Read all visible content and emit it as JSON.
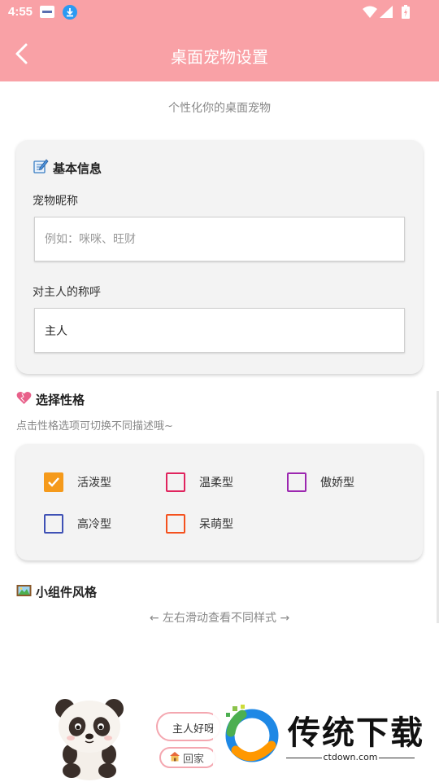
{
  "status_bar": {
    "time": "4:55"
  },
  "header": {
    "title": "桌面宠物设置",
    "background": "#f9a1a6"
  },
  "subtitle": "个性化你的桌面宠物",
  "basic_info": {
    "heading": "基本信息",
    "nickname_label": "宠物昵称",
    "nickname_placeholder": "例如：咪咪、旺财",
    "nickname_value": "",
    "owner_label": "对主人的称呼",
    "owner_value": "主人"
  },
  "personality": {
    "heading": "选择性格",
    "hint": "点击性格选项可切换不同描述哦~",
    "options": [
      {
        "label": "活泼型",
        "checked": true,
        "color": "#f59a1b"
      },
      {
        "label": "温柔型",
        "checked": false,
        "color": "#e0245e"
      },
      {
        "label": "傲娇型",
        "checked": false,
        "color": "#9c27b0"
      },
      {
        "label": "高冷型",
        "checked": false,
        "color": "#3f51b5"
      },
      {
        "label": "呆萌型",
        "checked": false,
        "color": "#f4511e"
      }
    ]
  },
  "widget_style": {
    "heading": "小组件风格",
    "swipe_hint": "← 左右滑动查看不同样式 →",
    "preview_bubble": "主人好呀",
    "home_button": "回家"
  },
  "watermark": {
    "brand": "传统下载",
    "domain": "ctdown.com"
  }
}
